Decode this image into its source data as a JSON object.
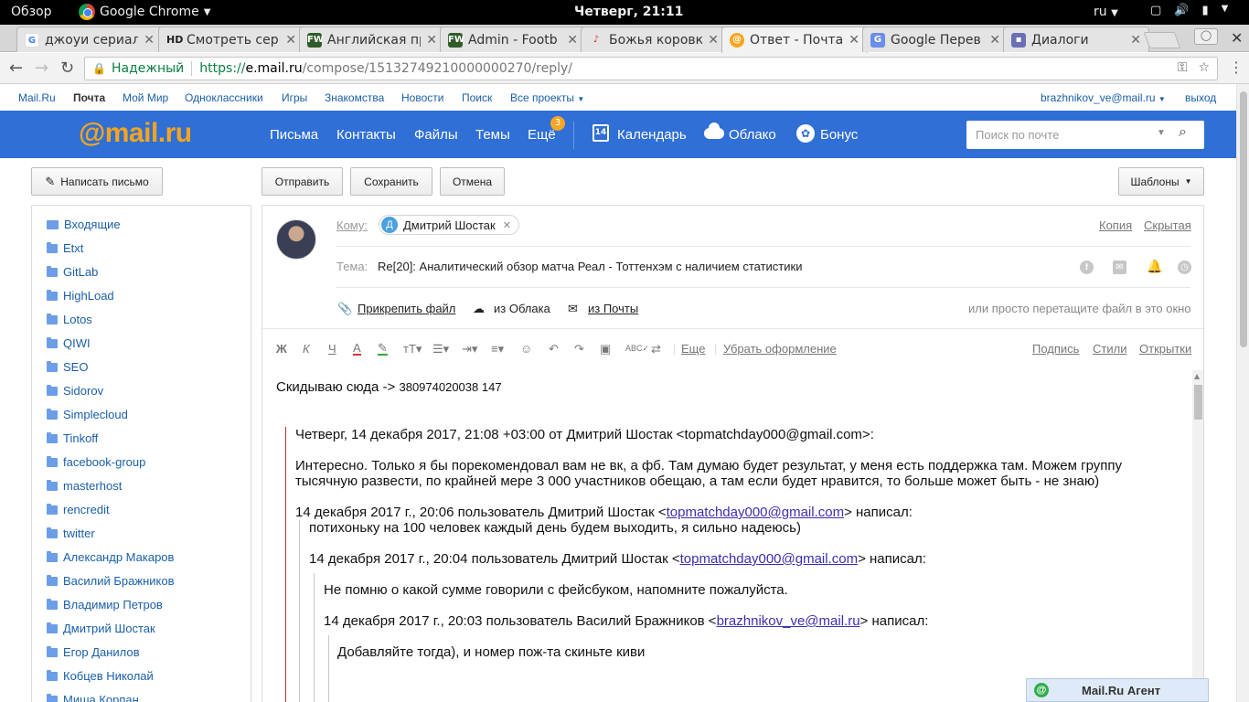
{
  "gnome": {
    "activities": "Обзор",
    "app_name": "Google Chrome",
    "clock": "Четверг, 21:11",
    "lang": "ru"
  },
  "tabs": [
    {
      "title": "джоуи сериал",
      "fav": "G",
      "color": "#ffffff"
    },
    {
      "title": "Смотреть сер",
      "fav": "HD",
      "color": "#222222"
    },
    {
      "title": "Английская пр",
      "fav": "FW",
      "color": "#2f5c2a"
    },
    {
      "title": "Admin - Footb",
      "fav": "FW",
      "color": "#2f5c2a"
    },
    {
      "title": "Божья коровк",
      "fav": "♪",
      "color": "#f2f2f2"
    },
    {
      "title": "Ответ - Почта",
      "fav": "@",
      "color": "#f9a41a"
    },
    {
      "title": "Google Перев",
      "fav": "G",
      "color": "#6b8ee8"
    },
    {
      "title": "Диалоги",
      "fav": "▪",
      "color": "#6b6fb5"
    }
  ],
  "address": {
    "secure_label": "Надежный",
    "scheme": "https://",
    "host": "e.mail.ru",
    "path": "/compose/15132749210000000270/reply/"
  },
  "portal_nav": {
    "items": [
      "Mail.Ru",
      "Почта",
      "Мой Мир",
      "Одноклассники",
      "Игры",
      "Знакомства",
      "Новости",
      "Поиск",
      "Все проекты"
    ],
    "user": "brazhnikov_ve@mail.ru",
    "logout": "выход"
  },
  "header": {
    "logo": "@mail.ru",
    "nav": [
      "Письма",
      "Контакты",
      "Файлы",
      "Темы",
      "Ещё"
    ],
    "more_badge": "3",
    "calendar": "Календарь",
    "calendar_day": "14",
    "cloud": "Облако",
    "bonus": "Бонус",
    "search_placeholder": "Поиск по почте"
  },
  "toolbar": {
    "compose": "Написать письмо",
    "send": "Отправить",
    "save": "Сохранить",
    "cancel": "Отмена",
    "templates": "Шаблоны"
  },
  "folders": [
    "Входящие",
    "Etxt",
    "GitLab",
    "HighLoad",
    "Lotos",
    "QIWI",
    "SEO",
    "Sidorov",
    "Simplecloud",
    "Tinkoff",
    "facebook-group",
    "masterhost",
    "rencredit",
    "twitter",
    "Александр Макаров",
    "Василий Бражников",
    "Владимир Петров",
    "Дмитрий Шостак",
    "Егор Данилов",
    "Кобцев Николай",
    "Миша Корпан"
  ],
  "compose": {
    "to_label": "Кому",
    "recipient_initial": "Д",
    "recipient": "Дмитрий Шостак",
    "copy": "Копия",
    "hidden": "Скрытая",
    "subject_label": "Тема:",
    "subject": "Re[20]: Аналитический обзор матча Реал - Тоттенхэм с наличием статистики",
    "attach_file": "Прикрепить файл",
    "from_cloud": "из Облака",
    "from_mail": "из Почты",
    "drag_hint": "или просто перетащите файл в это окно",
    "more": "Еще",
    "clear_format": "Убрать оформление",
    "signature": "Подпись",
    "styles": "Стили",
    "cards": "Открытки"
  },
  "body": {
    "line1_text": "Скидываю сюда -> ",
    "line1_num": "380974020038 147",
    "q1_header": "Четверг, 14 декабря 2017, 21:08 +03:00 от Дмитрий Шостак <topmatchday000@gmail.com>:",
    "q1_text_a": "Интересно. Только я бы порекомендовал вам не вк, а фб. Там думаю будет результат, у меня есть поддержка там. Можем группу",
    "q1_text_b": "тысячную развести, по крайней мере 3 000 участников обещаю, а там если будет нравится, то больше может быть - не знаю)",
    "q2_header_pre": "14 декабря 2017 г., 20:06 пользователь Дмитрий Шостак <",
    "q2_email": "topmatchday000@gmail.com",
    "q2_header_post": "> написал:",
    "q2_text": "потихоньку на 100 человек каждый день будем выходить, я сильно надеюсь)",
    "q3_header_pre": "14 декабря 2017 г., 20:04 пользователь Дмитрий Шостак <",
    "q3_email": "topmatchday000@gmail.com",
    "q3_header_post": "> написал:",
    "q3_text": "Не помню о какой сумме говорили с фейсбуком, напомните пожалуйста.",
    "q4_header_pre": "14 декабря 2017 г., 20:03 пользователь Василий Бражников <",
    "q4_email": "brazhnikov_ve@mail.ru",
    "q4_header_post": "> написал:",
    "q4_text": "Добавляйте тогда), и номер пож-та скиньте киви"
  },
  "agent": {
    "label": "Mail.Ru Агент"
  }
}
